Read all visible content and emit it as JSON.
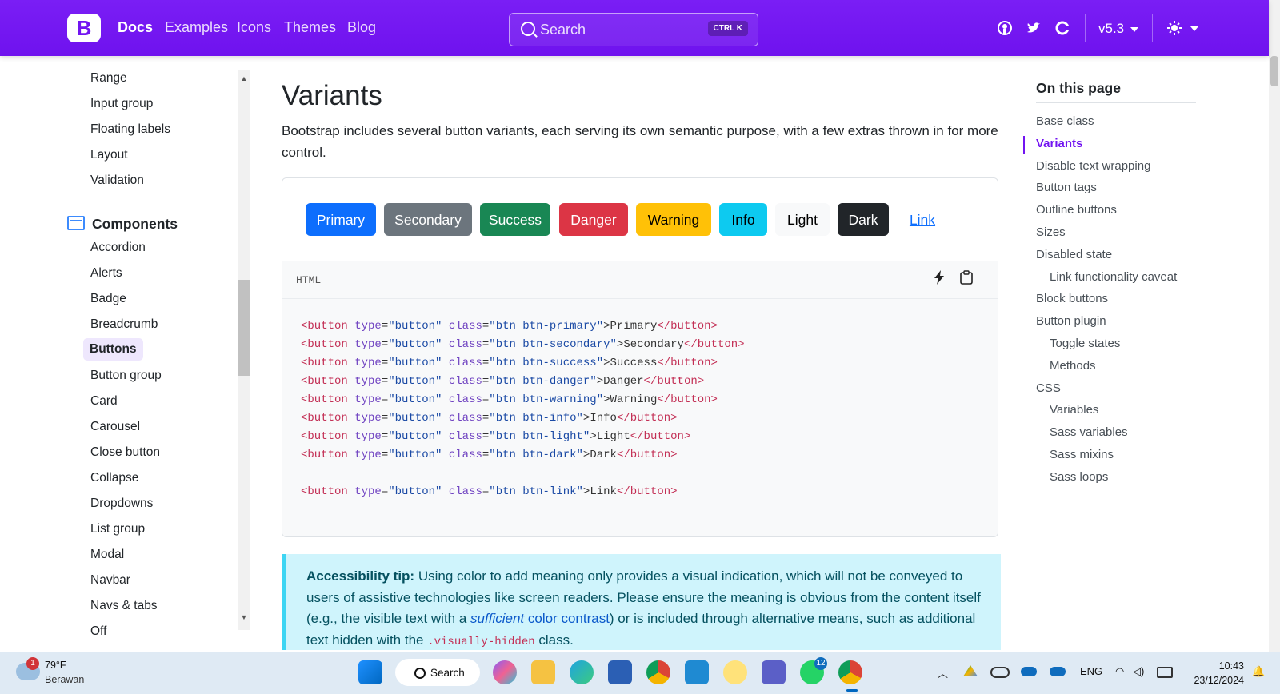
{
  "navbar": {
    "brand": "B",
    "links": [
      "Docs",
      "Examples",
      "Icons",
      "Themes",
      "Blog"
    ],
    "search_placeholder": "Search",
    "search_shortcut": "CTRL K",
    "version": "v5.3"
  },
  "sidebar": {
    "items_top": [
      "Range",
      "Input group",
      "Floating labels",
      "Layout",
      "Validation"
    ],
    "section": "Components",
    "items": [
      "Accordion",
      "Alerts",
      "Badge",
      "Breadcrumb",
      "Buttons",
      "Button group",
      "Card",
      "Carousel",
      "Close button",
      "Collapse",
      "Dropdowns",
      "List group",
      "Modal",
      "Navbar",
      "Navs & tabs",
      "Off"
    ],
    "active_item": "Buttons"
  },
  "main": {
    "title": "Variants",
    "lead": "Bootstrap includes several button variants, each serving its own semantic purpose, with a few extras thrown in for more control.",
    "buttons": [
      "Primary",
      "Secondary",
      "Success",
      "Danger",
      "Warning",
      "Info",
      "Light",
      "Dark",
      "Link"
    ],
    "code_lang": "HTML",
    "code_classes": [
      "btn btn-primary",
      "btn btn-secondary",
      "btn btn-success",
      "btn btn-danger",
      "btn btn-warning",
      "btn btn-info",
      "btn btn-light",
      "btn btn-dark",
      "btn btn-link"
    ],
    "callout": {
      "bold": "Accessibility tip:",
      "text1": " Using color to add meaning only provides a visual indication, which will not be conveyed to users of assistive technologies like screen readers. Please ensure the meaning is obvious from the content itself (e.g., the visible text with a ",
      "link1": "sufficient",
      "link2": "color contrast",
      "text2": ") or is included through alternative means, such as additional text hidden with the ",
      "code": ".visually-hidden",
      "text3": " class."
    }
  },
  "toc": {
    "title": "On this page",
    "items": [
      {
        "label": "Base class",
        "sub": false
      },
      {
        "label": "Variants",
        "sub": false,
        "active": true
      },
      {
        "label": "Disable text wrapping",
        "sub": false
      },
      {
        "label": "Button tags",
        "sub": false
      },
      {
        "label": "Outline buttons",
        "sub": false
      },
      {
        "label": "Sizes",
        "sub": false
      },
      {
        "label": "Disabled state",
        "sub": false
      },
      {
        "label": "Link functionality caveat",
        "sub": true
      },
      {
        "label": "Block buttons",
        "sub": false
      },
      {
        "label": "Button plugin",
        "sub": false
      },
      {
        "label": "Toggle states",
        "sub": true
      },
      {
        "label": "Methods",
        "sub": true
      },
      {
        "label": "CSS",
        "sub": false
      },
      {
        "label": "Variables",
        "sub": true
      },
      {
        "label": "Sass variables",
        "sub": true
      },
      {
        "label": "Sass mixins",
        "sub": true
      },
      {
        "label": "Sass loops",
        "sub": true
      }
    ]
  },
  "taskbar": {
    "weather_temp": "79°F",
    "weather_desc": "Berawan",
    "weather_badge": "1",
    "search_label": "Search",
    "whatsapp_badge": "12",
    "lang": "ENG",
    "time": "10:43",
    "date": "23/12/2024"
  },
  "colors": {
    "brand": "#7214f1",
    "primary": "#0d6efd",
    "callout_bg": "#cff4fc"
  }
}
